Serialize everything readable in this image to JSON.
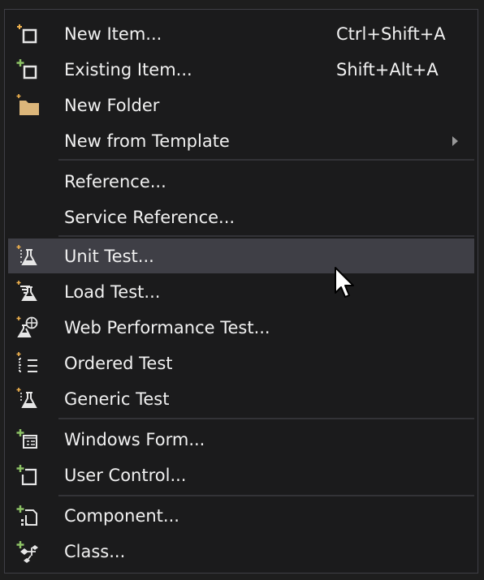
{
  "colors": {
    "menu_bg": "#1b1b1c",
    "highlight": "#3f3f46",
    "text": "#f1f1f1",
    "icon_green": "#8cc265",
    "icon_orange": "#f0b24e",
    "folder": "#dcb67a"
  },
  "menu": {
    "items": [
      {
        "label": "New Item...",
        "shortcut": "Ctrl+Shift+A",
        "icon": "new-item-icon"
      },
      {
        "label": "Existing Item...",
        "shortcut": "Shift+Alt+A",
        "icon": "existing-item-icon"
      },
      {
        "label": "New Folder",
        "icon": "folder-icon"
      },
      {
        "label": "New from Template",
        "icon": "none",
        "submenu": true
      },
      {
        "label": "Reference...",
        "icon": "none"
      },
      {
        "label": "Service Reference...",
        "icon": "none"
      },
      {
        "label": "Unit Test...",
        "icon": "unit-test-icon",
        "highlighted": true
      },
      {
        "label": "Load Test...",
        "icon": "load-test-icon"
      },
      {
        "label": "Web Performance Test...",
        "icon": "web-performance-test-icon"
      },
      {
        "label": "Ordered Test",
        "icon": "ordered-test-icon"
      },
      {
        "label": "Generic Test",
        "icon": "generic-test-icon"
      },
      {
        "label": "Windows Form...",
        "icon": "windows-form-icon"
      },
      {
        "label": "User Control...",
        "icon": "user-control-icon"
      },
      {
        "label": "Component...",
        "icon": "component-icon"
      },
      {
        "label": "Class...",
        "icon": "class-icon"
      }
    ]
  }
}
